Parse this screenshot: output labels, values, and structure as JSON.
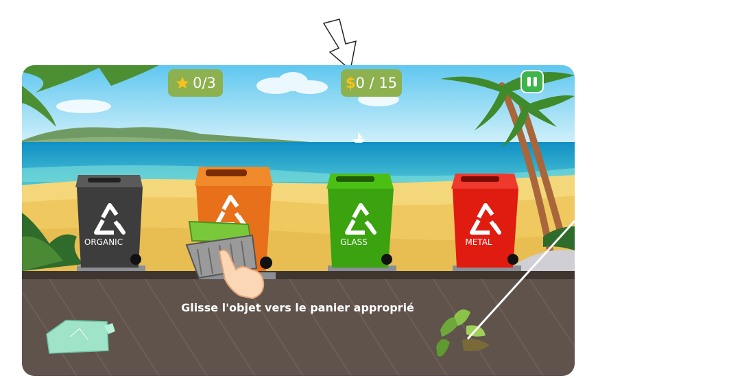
{
  "hud": {
    "stars": "0/3",
    "coins": "0 / 15",
    "coin_symbol": "$"
  },
  "bins": [
    {
      "label": "ORGANIC",
      "color": "#3d3d3d"
    },
    {
      "label": "",
      "color": "#e8701a"
    },
    {
      "label": "GLASS",
      "color": "#3aa30f"
    },
    {
      "label": "METAL",
      "color": "#e01b10"
    }
  ],
  "hint": "Glisse l'objet vers le panier approprié",
  "icons": [
    "star-icon",
    "coin-icon",
    "pause-icon",
    "recycle-icon",
    "hand-pointer-icon",
    "pointer-arrow-icon"
  ],
  "colors": {
    "hud_bg": "#8db14f",
    "pause_bg": "#3fb44a",
    "floor": "#5f534b"
  }
}
